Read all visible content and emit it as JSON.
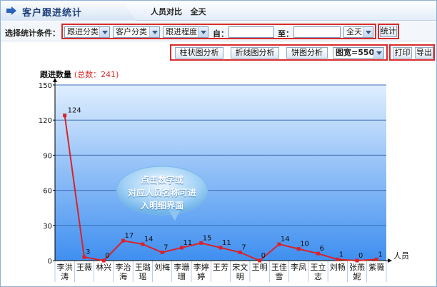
{
  "header": {
    "title": "客户跟进统计",
    "subtitle": "人员对比   全天"
  },
  "filters": {
    "label": "选择统计条件：",
    "follow_category": "跟进分类",
    "customer_category": "客户分类",
    "follow_level": "跟进程度",
    "from_label": "自：",
    "from_value": "",
    "to_label": "至：",
    "to_value": "",
    "time_range": "全天",
    "stat_button": "统计"
  },
  "toolbar": {
    "bar_button": "柱状图分析",
    "line_button": "折线图分析",
    "pie_button": "饼图分析",
    "width_select": "图宽=550",
    "print_button": "打印",
    "export_button": "导出"
  },
  "colors": {
    "line": "#d8232a",
    "fill_top": "#dfeefe",
    "fill_bottom": "#3f8ff0",
    "grid": "#3d6fb8",
    "axis": "#000000",
    "highlight_box": "#d82c2c"
  },
  "bubble": {
    "line1": "点击数字或",
    "line2": "对应人员名称可进",
    "line3": "入明细界面"
  },
  "chart_data": {
    "type": "line",
    "title": "跟进数量",
    "total_label": "(总数：241)",
    "xlabel": "人员",
    "ylabel": "",
    "ylim": [
      0,
      150
    ],
    "yticks": [
      0,
      30,
      60,
      90,
      120,
      150
    ],
    "grid": true,
    "categories": [
      "李洪涛",
      "王薇",
      "林兴",
      "李治海",
      "王璐瑶",
      "刘梅",
      "李珊珊",
      "李婷婷",
      "王芳",
      "宋文明",
      "王明",
      "王佳雪",
      "李凤",
      "王立志",
      "刘畅",
      "张燕妮",
      "紫薇"
    ],
    "category_lines": [
      [
        "李洪",
        "涛"
      ],
      [
        "王薇"
      ],
      [
        "林兴"
      ],
      [
        "李治",
        "海"
      ],
      [
        "王璐",
        "瑶"
      ],
      [
        "刘梅"
      ],
      [
        "李珊",
        "珊"
      ],
      [
        "李婷",
        "婷"
      ],
      [
        "王芳"
      ],
      [
        "宋文",
        "明"
      ],
      [
        "王明"
      ],
      [
        "王佳",
        "雪"
      ],
      [
        "李凤"
      ],
      [
        "王立",
        "志"
      ],
      [
        "刘畅"
      ],
      [
        "张燕",
        "妮"
      ],
      [
        "紫薇"
      ]
    ],
    "series": [
      {
        "values": [
          124,
          3,
          0,
          17,
          14,
          7,
          11,
          15,
          11,
          7,
          0,
          14,
          10,
          6,
          1,
          0,
          1
        ]
      }
    ]
  }
}
